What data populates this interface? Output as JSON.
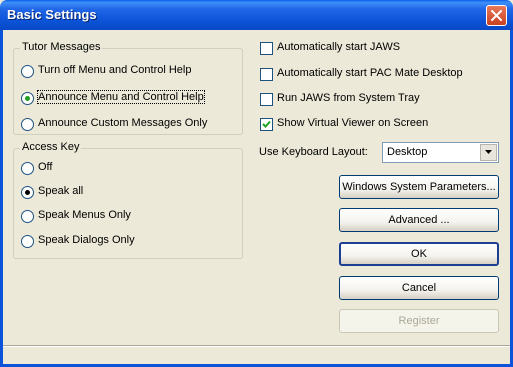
{
  "window": {
    "title": "Basic Settings"
  },
  "tutor_messages": {
    "legend": "Tutor Messages",
    "options": [
      {
        "label": "Turn off Menu and Control Help",
        "selected": false
      },
      {
        "label": "Announce Menu and Control Help",
        "selected": true
      },
      {
        "label": "Announce Custom Messages Only",
        "selected": false
      }
    ]
  },
  "access_key": {
    "legend": "Access Key",
    "options": [
      {
        "label": "Off",
        "selected": false
      },
      {
        "label": "Speak all",
        "selected": true
      },
      {
        "label": "Speak Menus Only",
        "selected": false
      },
      {
        "label": "Speak Dialogs Only",
        "selected": false
      }
    ]
  },
  "checkboxes": [
    {
      "label": "Automatically start JAWS",
      "checked": false
    },
    {
      "label": "Automatically start PAC Mate Desktop",
      "checked": false
    },
    {
      "label": "Run JAWS from System Tray",
      "checked": false
    },
    {
      "label": "Show Virtual Viewer on Screen",
      "checked": true
    }
  ],
  "keyboard_layout": {
    "label": "Use Keyboard Layout:",
    "value": "Desktop"
  },
  "buttons": {
    "system_parameters": "Windows System Parameters...",
    "advanced": "Advanced ...",
    "ok": "OK",
    "cancel": "Cancel",
    "register": "Register"
  }
}
